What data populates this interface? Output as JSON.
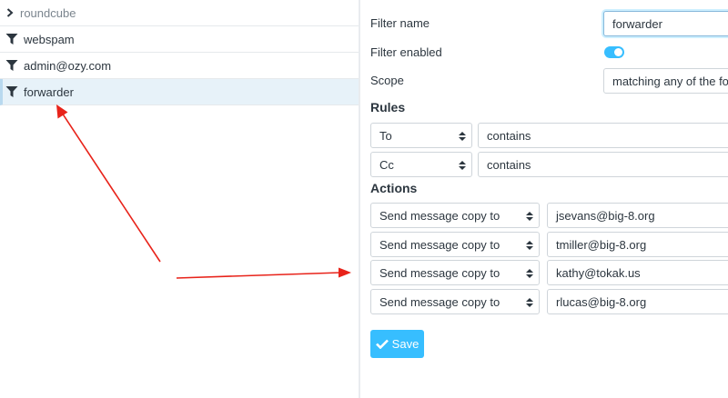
{
  "filter_list": {
    "group": {
      "label": "roundcube",
      "icon": "chevron-right-icon"
    },
    "items": [
      {
        "label": "webspam",
        "icon": "filter-icon"
      },
      {
        "label": "admin@ozy.com",
        "icon": "filter-icon"
      },
      {
        "label": "forwarder",
        "icon": "filter-icon",
        "selected": true
      }
    ]
  },
  "form": {
    "filter_name_label": "Filter name",
    "filter_name_value": "forwarder",
    "filter_enabled_label": "Filter enabled",
    "filter_enabled": true,
    "scope_label": "Scope",
    "scope_value": "matching any of the follow",
    "rules_heading": "Rules",
    "rules": [
      {
        "header": "To",
        "operator": "contains"
      },
      {
        "header": "Cc",
        "operator": "contains"
      }
    ],
    "actions_heading": "Actions",
    "actions": [
      {
        "type": "Send message copy to",
        "target": "jsevans@big-8.org"
      },
      {
        "type": "Send message copy to",
        "target": "tmiller@big-8.org"
      },
      {
        "type": "Send message copy to",
        "target": "kathy@tokak.us"
      },
      {
        "type": "Send message copy to",
        "target": "rlucas@big-8.org"
      }
    ],
    "save_label": "Save"
  },
  "colors": {
    "accent": "#37beff",
    "selected_row": "#e7f2f9",
    "annotation_arrow": "#e8231a"
  }
}
